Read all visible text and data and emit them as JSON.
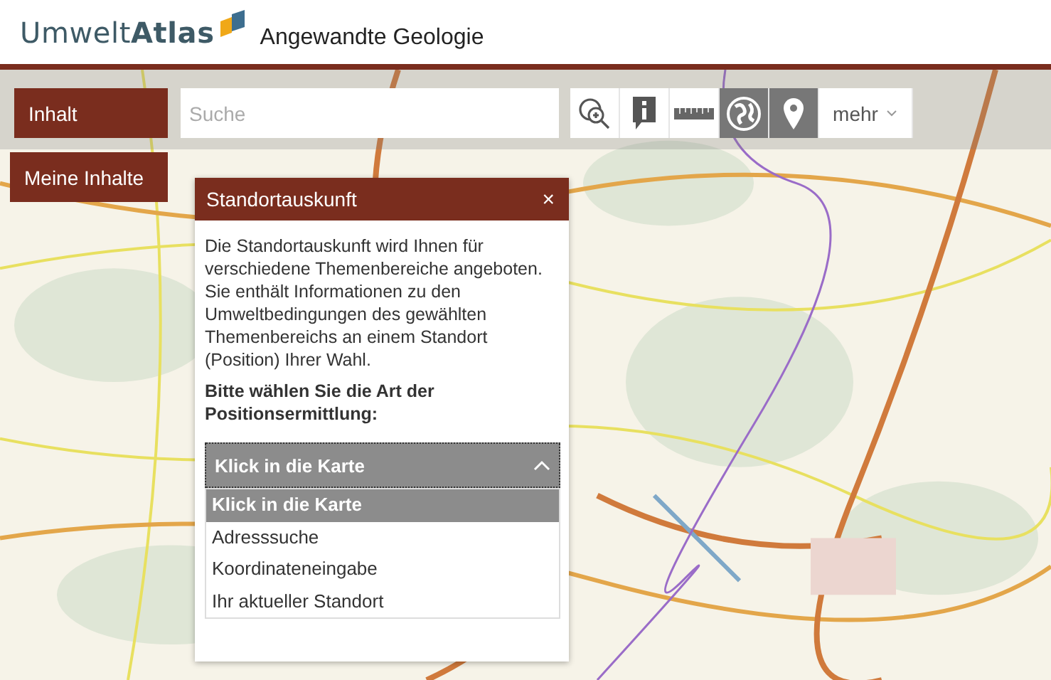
{
  "header": {
    "logo_light": "Umwelt",
    "logo_bold": "Atlas",
    "app_title": "Angewandte Geologie"
  },
  "nav_buttons": [
    {
      "label": "Inhalt"
    },
    {
      "label": "Meine Inhalte"
    }
  ],
  "search": {
    "placeholder": "Suche"
  },
  "toolbar": [
    {
      "kind": "zoom",
      "selected": false
    },
    {
      "kind": "info",
      "selected": false
    },
    {
      "kind": "ruler",
      "selected": false
    },
    {
      "kind": "globe",
      "selected": true
    },
    {
      "kind": "pin",
      "selected": true
    },
    {
      "kind": "more",
      "label": "mehr",
      "selected": false
    }
  ],
  "panel": {
    "title": "Standortauskunft",
    "close": "×",
    "description": "Die Standortauskunft wird Ihnen für verschiedene Themenbereiche angeboten. Sie enthält Informationen zu den Umweltbedingungen des gewählten Themenbereichs an einem Standort (Position) Ihrer Wahl.",
    "prompt": "Bitte wählen Sie die Art der Positionsermittlung:",
    "dropdown": {
      "value": "Klick in die Karte",
      "expanded": true
    },
    "options": [
      {
        "label": "Klick in die Karte",
        "selected": true
      },
      {
        "label": "Adresssuche",
        "selected": false
      },
      {
        "label": "Koordinateneingabe",
        "selected": false
      },
      {
        "label": "Ihr aktueller Standort",
        "selected": false
      }
    ]
  }
}
